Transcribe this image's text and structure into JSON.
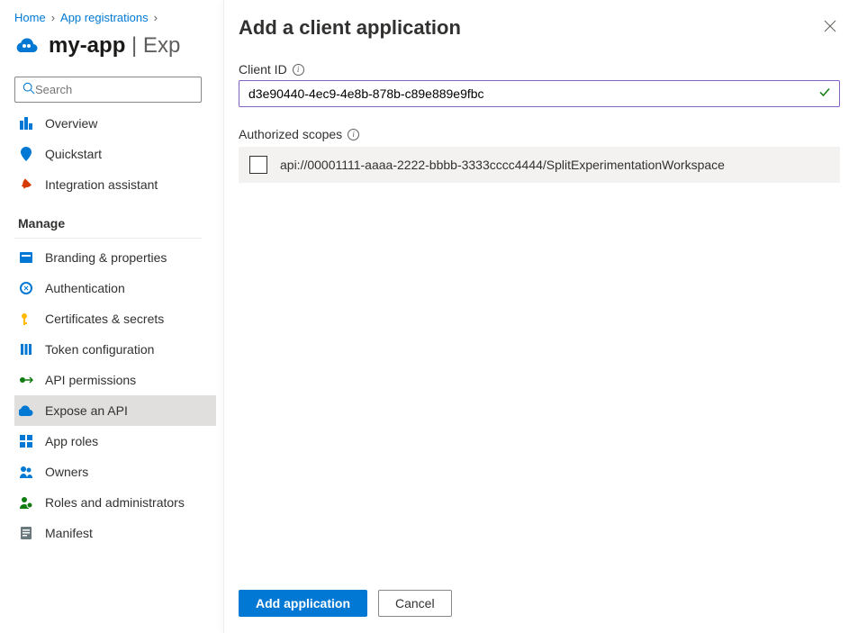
{
  "breadcrumb": {
    "home": "Home",
    "app_registrations": "App registrations"
  },
  "page_title": {
    "name": "my-app",
    "suffix": "| Exp"
  },
  "search": {
    "placeholder": "Search"
  },
  "nav": {
    "overview": "Overview",
    "quickstart": "Quickstart",
    "integration_assistant": "Integration assistant",
    "manage_header": "Manage",
    "branding": "Branding & properties",
    "authentication": "Authentication",
    "certificates": "Certificates & secrets",
    "token_config": "Token configuration",
    "api_permissions": "API permissions",
    "expose_api": "Expose an API",
    "app_roles": "App roles",
    "owners": "Owners",
    "roles_admins": "Roles and administrators",
    "manifest": "Manifest"
  },
  "panel": {
    "title": "Add a client application",
    "client_id_label": "Client ID",
    "client_id_value": "d3e90440-4ec9-4e8b-878b-c89e889e9fbc",
    "scopes_label": "Authorized scopes",
    "scope_value": "api://00001111-aaaa-2222-bbbb-3333cccc4444/SplitExperimentationWorkspace",
    "add_button": "Add application",
    "cancel_button": "Cancel"
  },
  "colors": {
    "primary": "#0078d4",
    "accent_purple": "#8661c5",
    "success": "#107c10"
  }
}
